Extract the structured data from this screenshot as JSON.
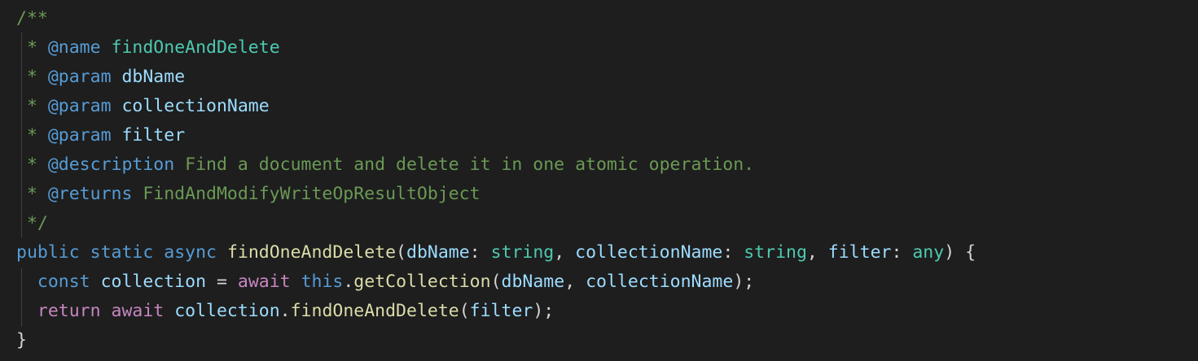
{
  "editor": {
    "language": "typescript",
    "theme": "dark",
    "lines": [
      [
        {
          "t": "/**",
          "k": "comment"
        }
      ],
      [
        {
          "t": " * ",
          "k": "comment"
        },
        {
          "t": "@name",
          "k": "tag"
        },
        {
          "t": " ",
          "k": "comment"
        },
        {
          "t": "findOneAndDelete",
          "k": "name"
        }
      ],
      [
        {
          "t": " * ",
          "k": "comment"
        },
        {
          "t": "@param",
          "k": "tag"
        },
        {
          "t": " ",
          "k": "comment"
        },
        {
          "t": "dbName",
          "k": "param"
        }
      ],
      [
        {
          "t": " * ",
          "k": "comment"
        },
        {
          "t": "@param",
          "k": "tag"
        },
        {
          "t": " ",
          "k": "comment"
        },
        {
          "t": "collectionName",
          "k": "param"
        }
      ],
      [
        {
          "t": " * ",
          "k": "comment"
        },
        {
          "t": "@param",
          "k": "tag"
        },
        {
          "t": " ",
          "k": "comment"
        },
        {
          "t": "filter",
          "k": "param"
        }
      ],
      [
        {
          "t": " * ",
          "k": "comment"
        },
        {
          "t": "@description",
          "k": "tag"
        },
        {
          "t": " Find a document and delete it in one atomic operation.",
          "k": "comment"
        }
      ],
      [
        {
          "t": " * ",
          "k": "comment"
        },
        {
          "t": "@returns",
          "k": "tag"
        },
        {
          "t": " FindAndModifyWriteOpResultObject",
          "k": "comment"
        }
      ],
      [
        {
          "t": " */",
          "k": "comment"
        }
      ],
      [
        {
          "t": "public",
          "k": "kw"
        },
        {
          "t": " ",
          "k": "punc"
        },
        {
          "t": "static",
          "k": "kw"
        },
        {
          "t": " ",
          "k": "punc"
        },
        {
          "t": "async",
          "k": "kw"
        },
        {
          "t": " ",
          "k": "punc"
        },
        {
          "t": "findOneAndDelete",
          "k": "fn"
        },
        {
          "t": "(",
          "k": "punc"
        },
        {
          "t": "dbName",
          "k": "var"
        },
        {
          "t": ": ",
          "k": "punc"
        },
        {
          "t": "string",
          "k": "type"
        },
        {
          "t": ", ",
          "k": "punc"
        },
        {
          "t": "collectionName",
          "k": "var"
        },
        {
          "t": ": ",
          "k": "punc"
        },
        {
          "t": "string",
          "k": "type"
        },
        {
          "t": ", ",
          "k": "punc"
        },
        {
          "t": "filter",
          "k": "var"
        },
        {
          "t": ": ",
          "k": "punc"
        },
        {
          "t": "any",
          "k": "type"
        },
        {
          "t": ") {",
          "k": "punc"
        }
      ],
      [
        {
          "t": "  ",
          "k": "punc"
        },
        {
          "t": "const",
          "k": "kw"
        },
        {
          "t": " ",
          "k": "punc"
        },
        {
          "t": "collection",
          "k": "var"
        },
        {
          "t": " = ",
          "k": "punc"
        },
        {
          "t": "await",
          "k": "ctrl"
        },
        {
          "t": " ",
          "k": "punc"
        },
        {
          "t": "this",
          "k": "kw"
        },
        {
          "t": ".",
          "k": "punc"
        },
        {
          "t": "getCollection",
          "k": "fn"
        },
        {
          "t": "(",
          "k": "punc"
        },
        {
          "t": "dbName",
          "k": "var"
        },
        {
          "t": ", ",
          "k": "punc"
        },
        {
          "t": "collectionName",
          "k": "var"
        },
        {
          "t": ");",
          "k": "punc"
        }
      ],
      [
        {
          "t": "  ",
          "k": "punc"
        },
        {
          "t": "return",
          "k": "ctrl"
        },
        {
          "t": " ",
          "k": "punc"
        },
        {
          "t": "await",
          "k": "ctrl"
        },
        {
          "t": " ",
          "k": "punc"
        },
        {
          "t": "collection",
          "k": "var"
        },
        {
          "t": ".",
          "k": "punc"
        },
        {
          "t": "findOneAndDelete",
          "k": "fn"
        },
        {
          "t": "(",
          "k": "punc"
        },
        {
          "t": "filter",
          "k": "var"
        },
        {
          "t": ");",
          "k": "punc"
        }
      ],
      [
        {
          "t": "}",
          "k": "punc"
        }
      ]
    ]
  },
  "colors": {
    "background": "#1e1e1e",
    "comment": "#6a9955",
    "tag": "#569cd6",
    "keyword": "#569cd6",
    "control": "#c586c0",
    "function": "#dcdcaa",
    "type": "#4ec9b0",
    "variable": "#9cdcfe"
  }
}
